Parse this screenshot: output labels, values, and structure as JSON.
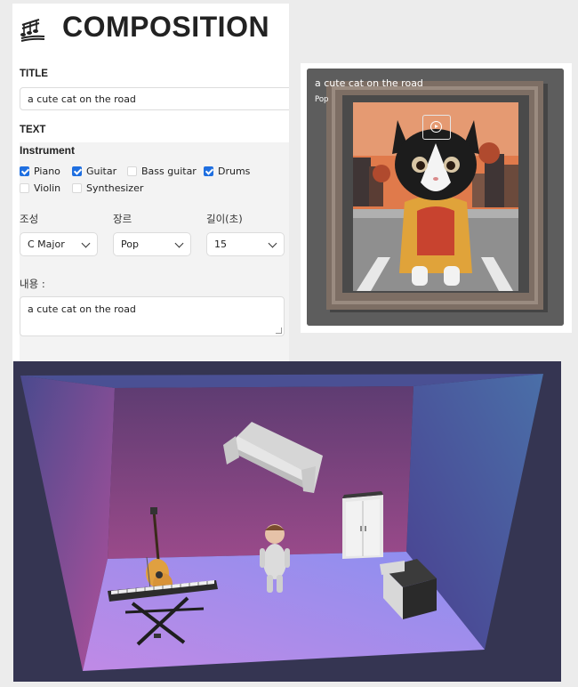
{
  "header": {
    "title": "COMPOSITION",
    "logo_icon": "music-notes-icon"
  },
  "form": {
    "title_label": "TITLE",
    "title_value": "a cute cat on the road",
    "text_label": "TEXT",
    "instrument_label": "Instrument",
    "instruments": [
      {
        "label": "Piano",
        "checked": true
      },
      {
        "label": "Guitar",
        "checked": true
      },
      {
        "label": "Bass guitar",
        "checked": false
      },
      {
        "label": "Drums",
        "checked": true
      },
      {
        "label": "Violin",
        "checked": false
      },
      {
        "label": "Synthesizer",
        "checked": false
      }
    ],
    "key_label": "조성",
    "key_value": "C Major",
    "genre_label": "장르",
    "genre_value": "Pop",
    "length_label": "길이(초)",
    "length_value": "15",
    "content_label": "내용 :",
    "content_value": "a cute cat on the road"
  },
  "card": {
    "title": "a cute cat on the road",
    "genre": "Pop",
    "play_icon": "play-circle-icon"
  },
  "scene": {
    "objects": [
      "floating-sofa",
      "wardrobe",
      "boy-avatar",
      "desk",
      "electric-guitar",
      "keyboard-piano-on-stand"
    ]
  }
}
